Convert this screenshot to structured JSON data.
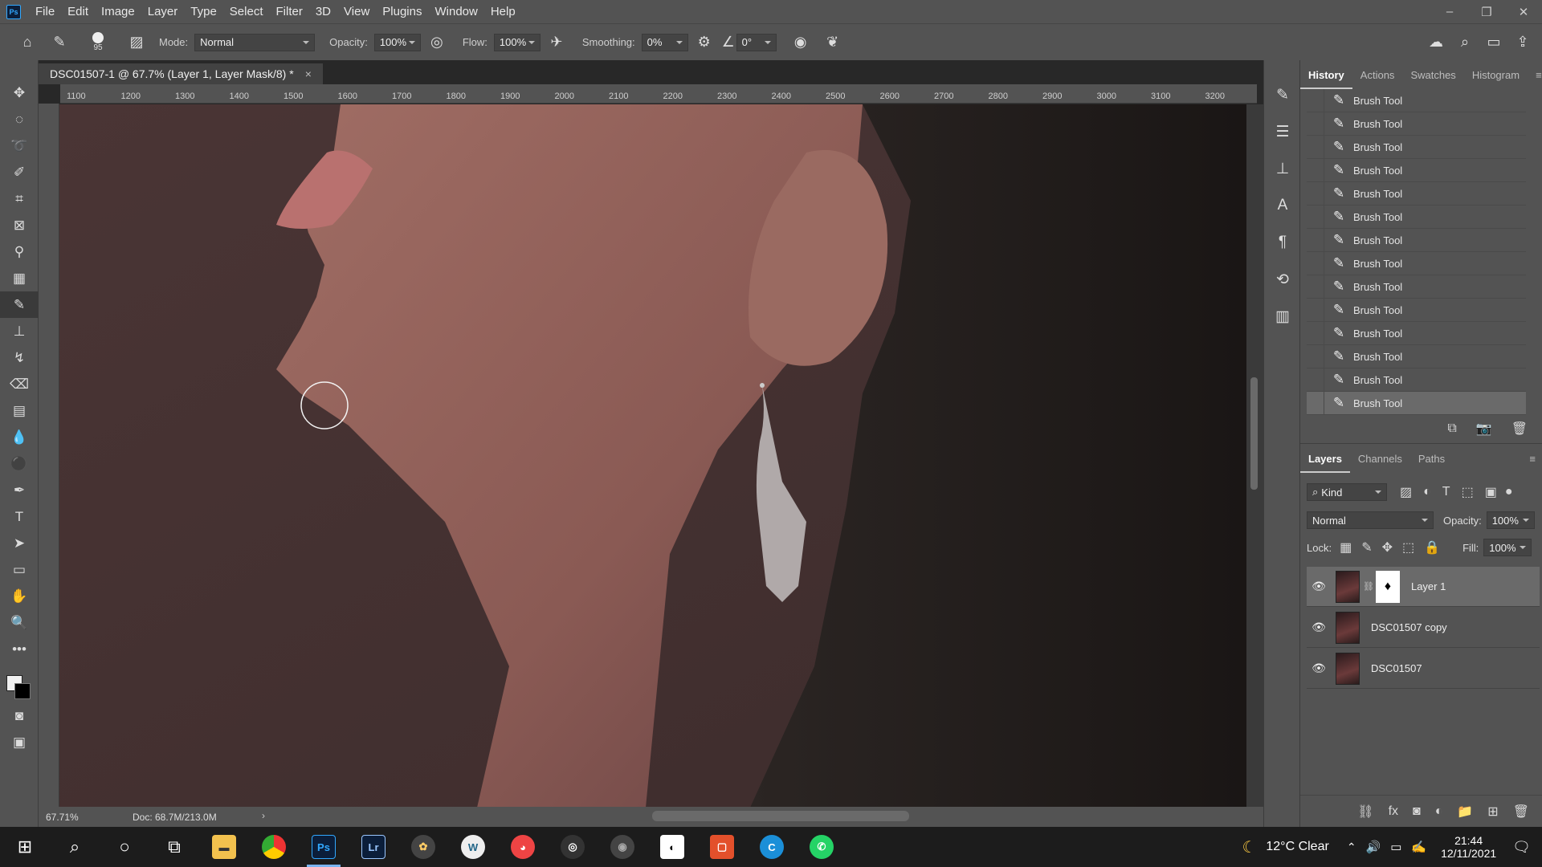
{
  "menu": [
    "File",
    "Edit",
    "Image",
    "Layer",
    "Type",
    "Select",
    "Filter",
    "3D",
    "View",
    "Plugins",
    "Window",
    "Help"
  ],
  "logo": "Ps",
  "options": {
    "brush_size": "95",
    "mode_label": "Mode:",
    "mode_value": "Normal",
    "opacity_label": "Opacity:",
    "opacity_value": "100%",
    "flow_label": "Flow:",
    "flow_value": "100%",
    "smoothing_label": "Smoothing:",
    "smoothing_value": "0%",
    "angle_value": "0°"
  },
  "document": {
    "tab_title": "DSC01507-1 @ 67.7% (Layer 1, Layer Mask/8) *",
    "zoom": "67.71%",
    "doc_size": "Doc: 68.7M/213.0M",
    "ruler_ticks": [
      "1100",
      "1200",
      "1300",
      "1400",
      "1500",
      "1600",
      "1700",
      "1800",
      "1900",
      "2000",
      "2100",
      "2200",
      "2300",
      "2400",
      "2500",
      "2600",
      "2700",
      "2800",
      "2900",
      "3000",
      "3100",
      "3200"
    ]
  },
  "history": {
    "tabs": [
      "History",
      "Actions",
      "Swatches",
      "Histogram"
    ],
    "items": [
      "Brush Tool",
      "Brush Tool",
      "Brush Tool",
      "Brush Tool",
      "Brush Tool",
      "Brush Tool",
      "Brush Tool",
      "Brush Tool",
      "Brush Tool",
      "Brush Tool",
      "Brush Tool",
      "Brush Tool",
      "Brush Tool",
      "Brush Tool"
    ]
  },
  "layers": {
    "tabs": [
      "Layers",
      "Channels",
      "Paths"
    ],
    "filter_kind": "Kind",
    "blend_mode": "Normal",
    "opacity_label": "Opacity:",
    "opacity_value": "100%",
    "lock_label": "Lock:",
    "fill_label": "Fill:",
    "fill_value": "100%",
    "items": [
      {
        "name": "Layer 1"
      },
      {
        "name": "DSC01507 copy"
      },
      {
        "name": "DSC01507"
      }
    ]
  },
  "taskbar": {
    "weather": "12°C  Clear",
    "time": "21:44",
    "date": "12/11/2021"
  }
}
